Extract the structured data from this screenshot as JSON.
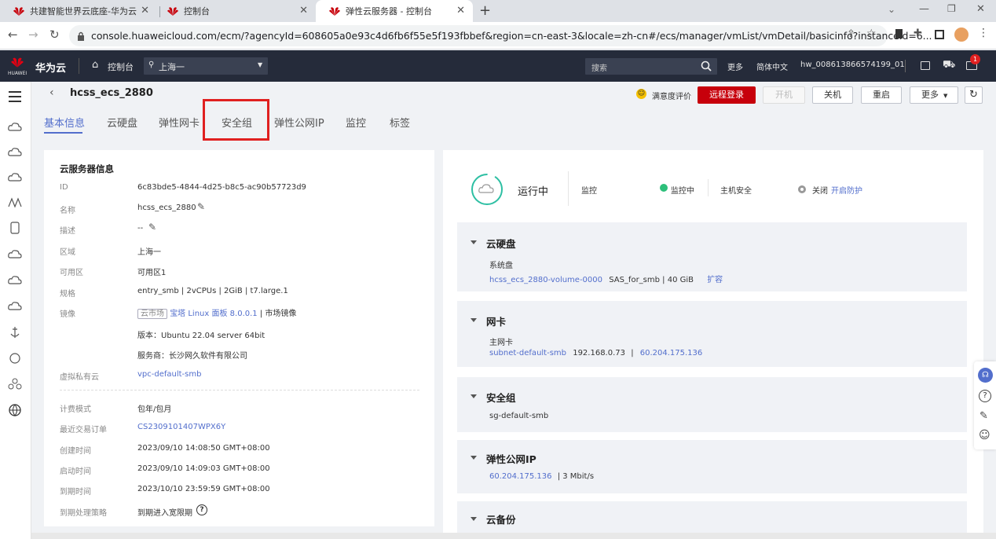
{
  "browser": {
    "tabs": [
      {
        "title": "共建智能世界云底座-华为云",
        "active": false
      },
      {
        "title": "控制台",
        "active": false
      },
      {
        "title": "弹性云服务器 - 控制台",
        "active": true
      }
    ],
    "url": "console.huaweicloud.com/ecm/?agencyId=608605a0e93c4d6fb6f55e5f193fbbef&region=cn-east-3&locale=zh-cn#/ecs/manager/vmList/vmDetail/basicinfo?instanceId=6..."
  },
  "header": {
    "logo_text": "HUAWEI",
    "brand": "华为云",
    "console": "控制台",
    "region": "上海一",
    "search_placeholder": "搜索",
    "more": "更多",
    "language": "简体中文",
    "user": "hw_008613866574199_01",
    "notification_count": "1"
  },
  "server": {
    "name": "hcss_ecs_2880",
    "satisfaction": "满意度评价",
    "btn_remote": "远程登录",
    "btn_start": "开机",
    "btn_stop": "关机",
    "btn_restart": "重启",
    "btn_more": "更多"
  },
  "tabs": [
    "基本信息",
    "云硬盘",
    "弹性网卡",
    "安全组",
    "弹性公网IP",
    "监控",
    "标签"
  ],
  "info": {
    "title": "云服务器信息",
    "rows": [
      {
        "label": "ID",
        "value": "6c83bde5-4844-4d25-b8c5-ac90b57723d9"
      },
      {
        "label": "名称",
        "value": "hcss_ecs_2880"
      },
      {
        "label": "描述",
        "value": "--"
      },
      {
        "label": "区域",
        "value": "上海一"
      },
      {
        "label": "可用区",
        "value": "可用区1"
      },
      {
        "label": "规格",
        "value": "entry_smb | 2vCPUs | 2GiB | t7.large.1"
      },
      {
        "label": "镜像",
        "tag": "云市场",
        "link": "宝塔 Linux 面板 8.0.0.1",
        "value": "| 市场镜像"
      },
      {
        "label": "",
        "value": "版本：Ubuntu 22.04 server 64bit"
      },
      {
        "label": "",
        "value": "服务商：长沙网久软件有限公司"
      },
      {
        "label": "虚拟私有云",
        "value": "vpc-default-smb"
      }
    ],
    "billing_rows": [
      {
        "label": "计费模式",
        "value": "包年/包月"
      },
      {
        "label": "最近交易订单",
        "value": "CS2309101407WPX6Y"
      },
      {
        "label": "创建时间",
        "value": "2023/09/10 14:08:50 GMT+08:00"
      },
      {
        "label": "启动时间",
        "value": "2023/09/10 14:09:03 GMT+08:00"
      },
      {
        "label": "到期时间",
        "value": "2023/10/10 23:59:59 GMT+08:00"
      },
      {
        "label": "到期处理策略",
        "value": "到期进入宽限期"
      }
    ]
  },
  "status": {
    "state": "运行中",
    "monitor_label": "监控",
    "monitor_value": "监控中",
    "host_security_label": "主机安全",
    "host_security_value": "关闭",
    "host_security_link": "开启防护"
  },
  "sections": {
    "disk": {
      "title": "云硬盘",
      "sub": "系统盘",
      "link": "hcss_ecs_2880-volume-0000",
      "detail": "SAS_for_smb | 40 GiB",
      "action": "扩容"
    },
    "nic": {
      "title": "网卡",
      "sub": "主网卡",
      "link": "subnet-default-smb",
      "ip": "192.168.0.73",
      "sep": "|",
      "eip": "60.204.175.136"
    },
    "sg": {
      "title": "安全组",
      "link": "sg-default-smb"
    },
    "eip": {
      "title": "弹性公网IP",
      "link": "60.204.175.136",
      "detail": "| 3 Mbit/s"
    },
    "backup": {
      "title": "云备份"
    }
  },
  "colors": {
    "accent": "#526ecc",
    "danger": "#c7000b",
    "header": "#252b3a",
    "highlight": "#e02020"
  }
}
